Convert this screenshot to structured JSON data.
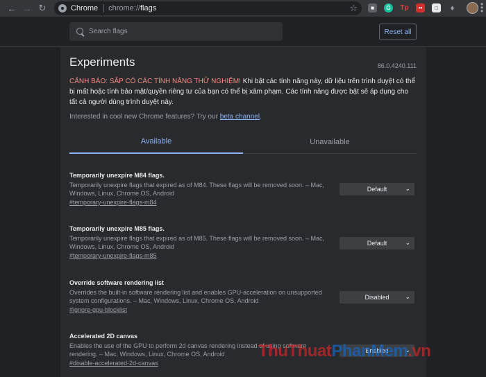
{
  "browser": {
    "site_chip": "Chrome",
    "url_scheme": "chrome://",
    "url_host": "flags"
  },
  "search": {
    "placeholder": "Search flags",
    "reset_label": "Reset all"
  },
  "page": {
    "title": "Experiments",
    "version": "86.0.4240.111",
    "warning_strong": "CẢNH BÁO: SẮP CÓ CÁC TÍNH NĂNG THỬ NGHIỆM!",
    "warning_text": " Khi bật các tính năng này, dữ liệu trên trình duyệt có thể bị mất hoặc tính bảo mật/quyền riêng tư của bạn có thể bị xâm phạm. Các tính năng được bật sẽ áp dụng cho tất cả người dùng trình duyệt này.",
    "interest_text": "Interested in cool new Chrome features? Try our ",
    "interest_link": "beta channel",
    "interest_end": "."
  },
  "tabs": {
    "available": "Available",
    "unavailable": "Unavailable"
  },
  "flags": [
    {
      "name": "Temporarily unexpire M84 flags.",
      "desc": "Temporarily unexpire flags that expired as of M84. These flags will be removed soon. – Mac, Windows, Linux, Chrome OS, Android",
      "link": "#temporary-unexpire-flags-m84",
      "value": "Default"
    },
    {
      "name": "Temporarily unexpire M85 flags.",
      "desc": "Temporarily unexpire flags that expired as of M85. These flags will be removed soon. – Mac, Windows, Linux, Chrome OS, Android",
      "link": "#temporary-unexpire-flags-m85",
      "value": "Default"
    },
    {
      "name": "Override software rendering list",
      "desc": "Overrides the built-in software rendering list and enables GPU-acceleration on unsupported system configurations. – Mac, Windows, Linux, Chrome OS, Android",
      "link": "#ignore-gpu-blocklist",
      "value": "Disabled"
    },
    {
      "name": "Accelerated 2D canvas",
      "desc": "Enables the use of the GPU to perform 2d canvas rendering instead of using software rendering. – Mac, Windows, Linux, Chrome OS, Android",
      "link": "#disable-accelerated-2d-canvas",
      "value": "Enabled"
    }
  ],
  "extensions": {
    "g_label": "G",
    "tp_label": "Tp"
  },
  "watermark": {
    "part1": "ThuThuat",
    "part2": "PhanMem",
    "part3": ".vn"
  },
  "colors": {
    "accent": "#8ab4f8",
    "warning": "#f28b82"
  }
}
